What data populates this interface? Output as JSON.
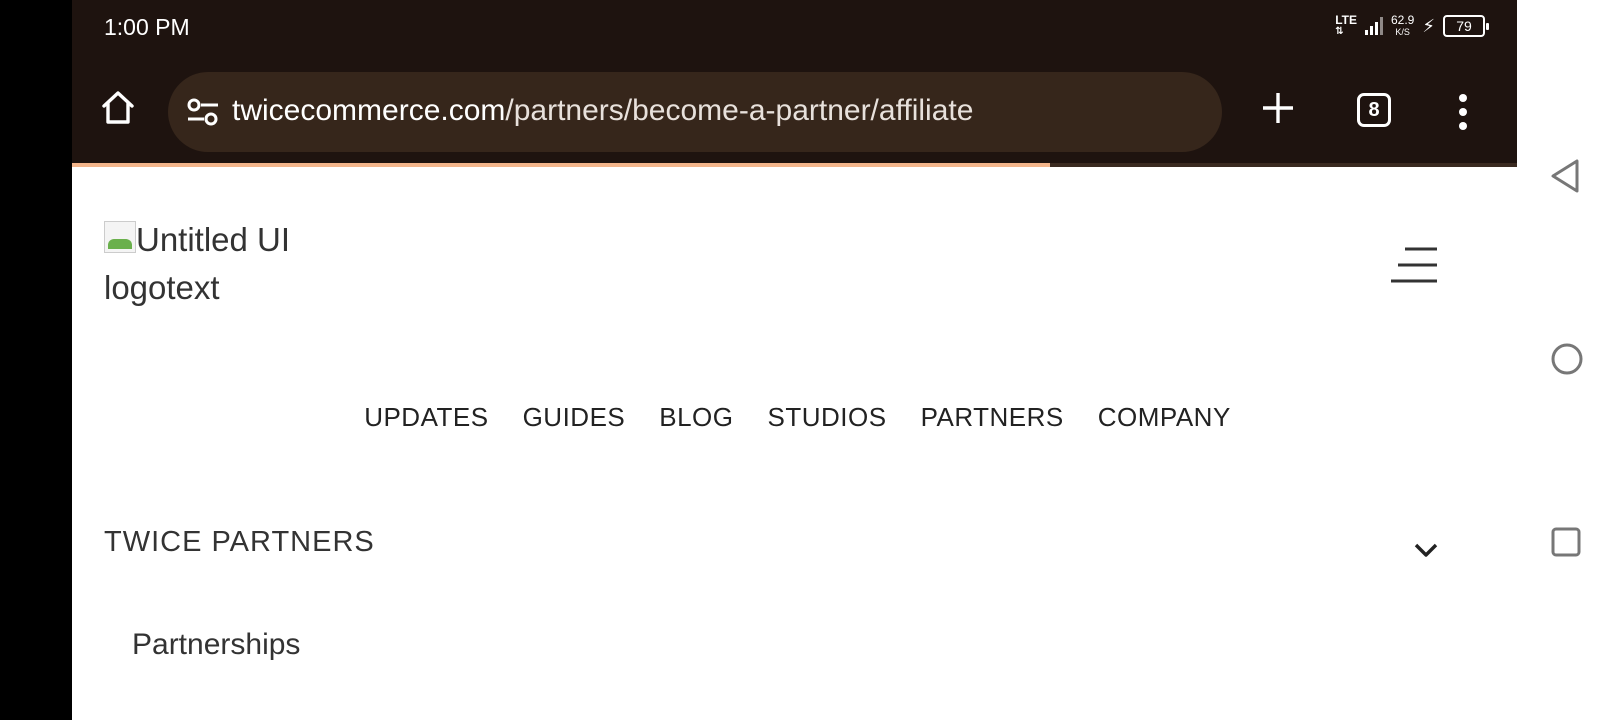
{
  "status": {
    "time": "1:00 PM",
    "network": "LTE",
    "speed_value": "62.9",
    "speed_unit": "K/S",
    "battery": "79"
  },
  "browser": {
    "url_host": "twicecommerce.com",
    "url_path": "/partners/become-a-partner/affiliate",
    "tab_count": "8",
    "load_progress": 0.677
  },
  "header": {
    "logo_alt": "Untitled UI logotext"
  },
  "nav": {
    "items": [
      "UPDATES",
      "GUIDES",
      "BLOG",
      "STUDIOS",
      "PARTNERS",
      "COMPANY"
    ]
  },
  "section": {
    "title": "TWICE PARTNERS",
    "sub_item": "Partnerships"
  },
  "colors": {
    "chrome_bg": "#1e130f",
    "urlbar_bg": "#36261b",
    "progress": "#f3b58b"
  },
  "icons": {
    "home": "home-icon",
    "tune": "site-settings-icon",
    "add": "plus-icon",
    "menu": "more-vert-icon",
    "hamburger": "hamburger-icon",
    "chevron": "chevron-down-icon"
  }
}
